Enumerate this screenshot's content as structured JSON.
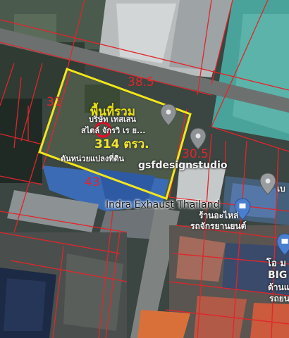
{
  "dimensions": {
    "top": "38.5",
    "left": "31",
    "right": "30.5",
    "bottom": "43"
  },
  "area": {
    "title": "พื้นที่รวม",
    "value": "314 ตรว."
  },
  "places": {
    "poi_1_line1": "บริษัท เทสเสน",
    "poi_1_line2": "สไตล์ จักรวิ เร ย...",
    "poi_2": "ดันหน่วยแปลงที่ดิน",
    "design_studio": "gsfdesignstudio",
    "indra": "Indra Exhaust Thailand",
    "thai_shop_1": "ร้านอะไหล่",
    "thai_shop_2": "รถจักรยานยนต์",
    "edge_1": "เบ",
    "edge_2": "โอ ม",
    "edge_3": "BIG",
    "edge_4": "ด้านแ",
    "edge_5": "รถยนต์"
  },
  "icons": {
    "poi_pin": "map-pin-icon",
    "subject_marker": "target-circle-icon",
    "shop_marker": "shopping-bag-icon"
  },
  "colors": {
    "boundary": "#f2e61c",
    "cadastral_lines": "#e0262b",
    "subject_marker": "#e8102a"
  }
}
